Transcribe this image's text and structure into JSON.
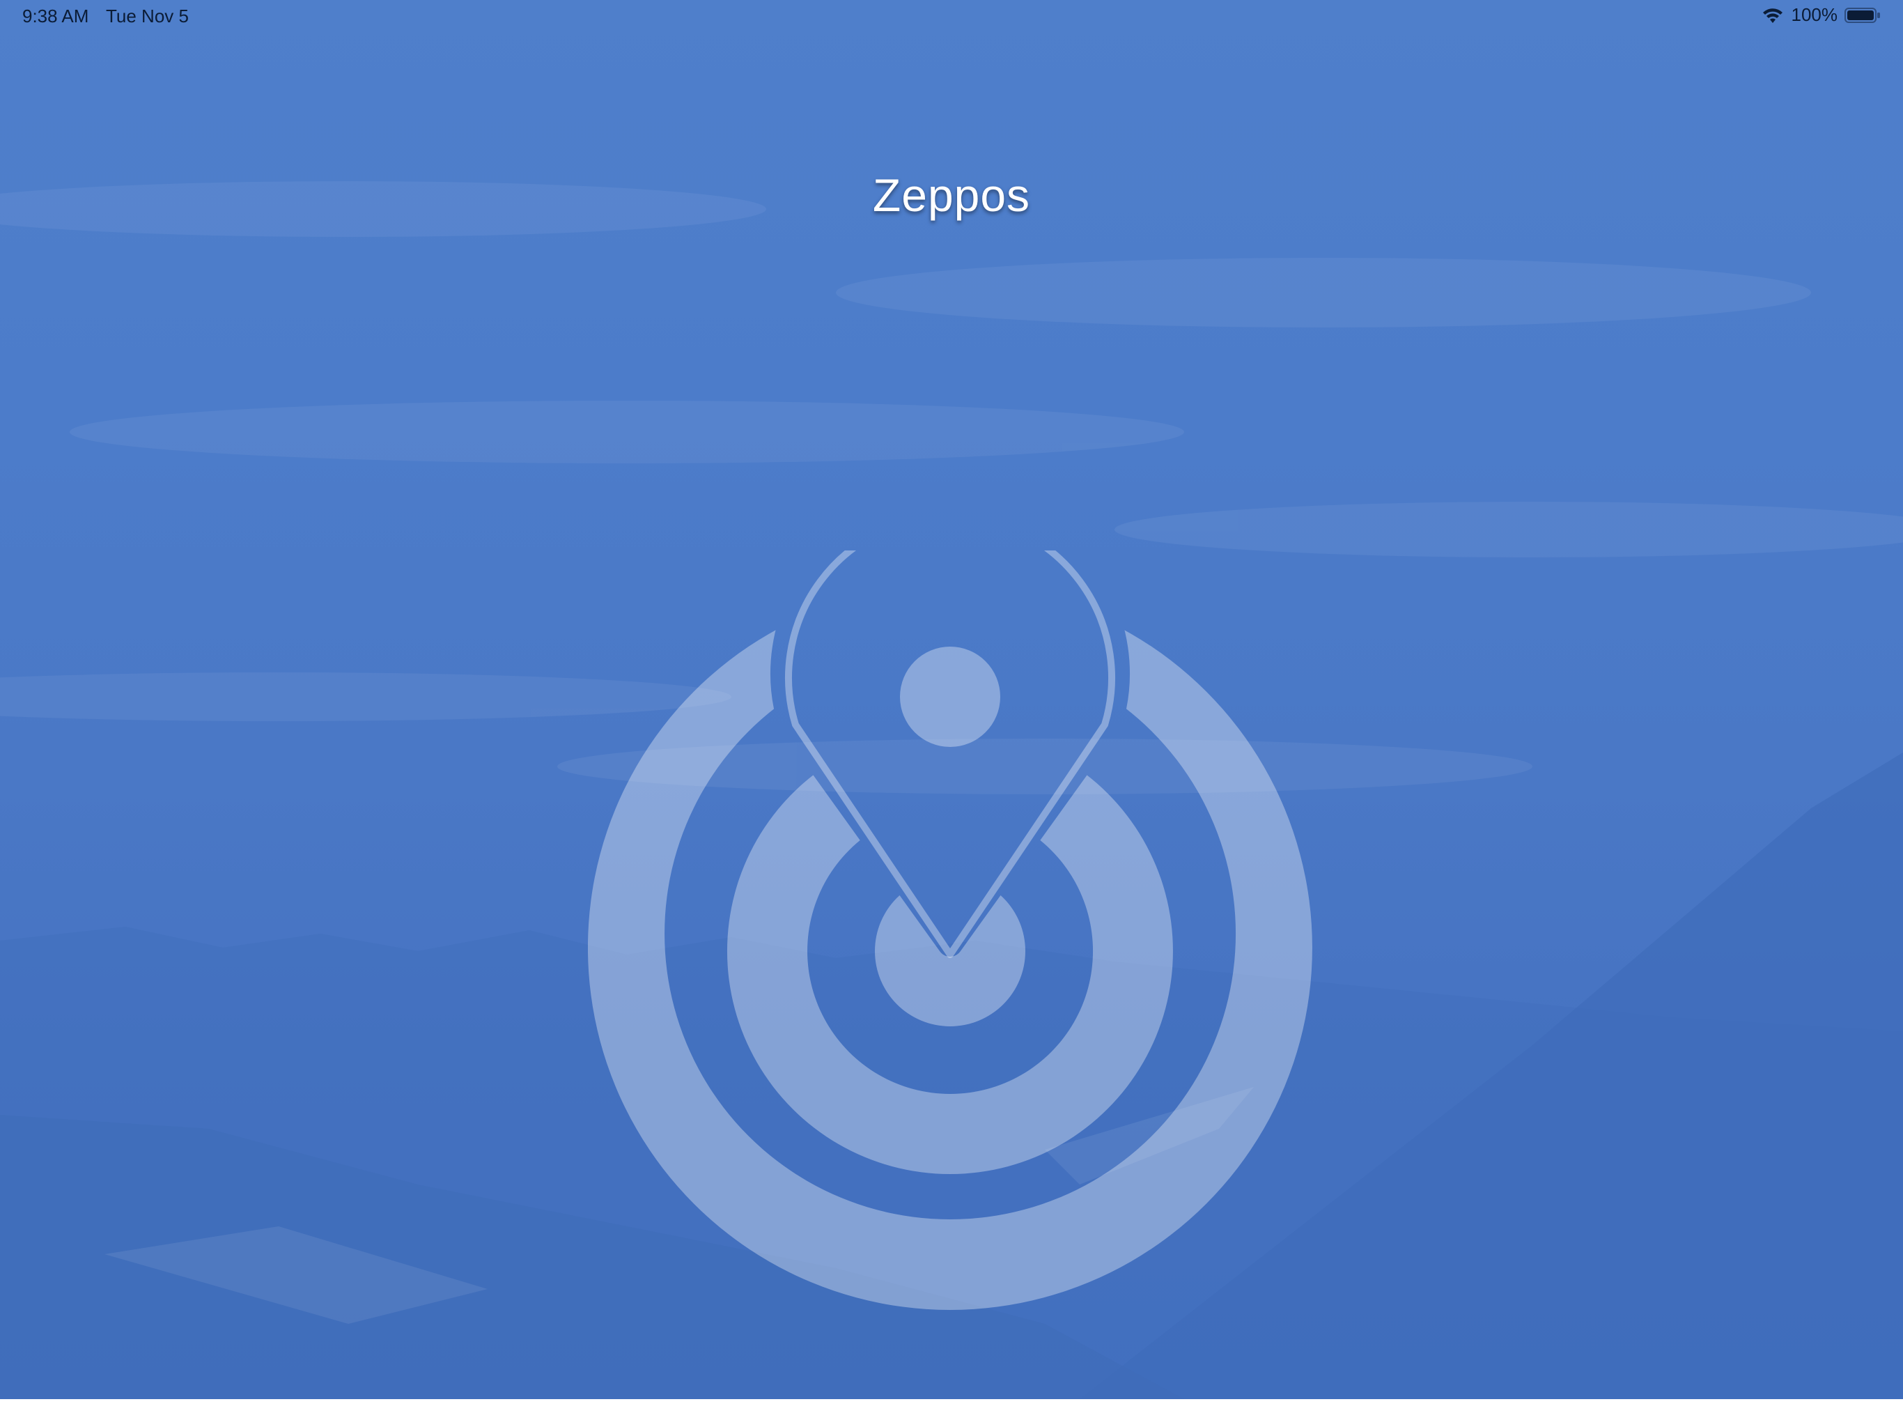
{
  "status_bar": {
    "time": "9:38 AM",
    "date": "Tue Nov 5",
    "battery_percent": "100%",
    "icons": [
      "wifi-icon",
      "battery-icon"
    ]
  },
  "app": {
    "title": "Zeppos",
    "logo_icon": "location-pin-target-icon"
  },
  "colors": {
    "background": "#4c7cca",
    "logo_fill": "#ffffff",
    "title": "#ffffff"
  }
}
